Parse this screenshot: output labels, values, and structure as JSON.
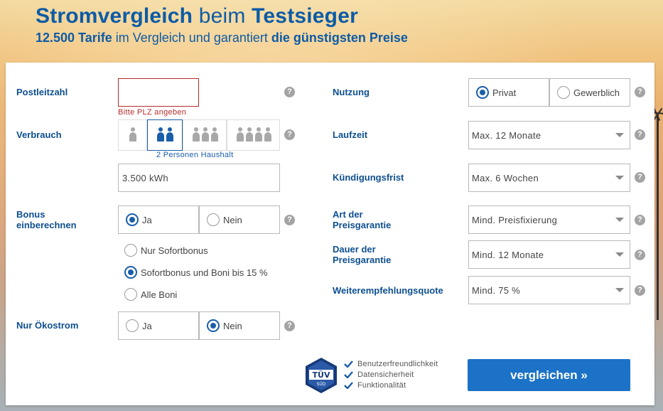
{
  "header": {
    "title_a": "Stromvergleich",
    "title_b": " beim ",
    "title_c": "Testsieger",
    "sub_a": "12.500 Tarife",
    "sub_b": " im Vergleich und garantiert ",
    "sub_c": "die günstigsten Preise"
  },
  "form": {
    "plz": {
      "label": "Postleitzahl",
      "value": "",
      "error": "Bitte PLZ angeben"
    },
    "verbrauch": {
      "label": "Verbrauch",
      "household_options": [
        1,
        2,
        3,
        4
      ],
      "selected_household": 2,
      "household_label": "2 Personen Haushalt",
      "kwh": "3.500 kWh"
    },
    "bonus": {
      "label_line1": "Bonus",
      "label_line2": "einberechnen",
      "yes": "Ja",
      "no": "Nein",
      "selected": "Ja",
      "options": [
        "Nur Sofortbonus",
        "Sofortbonus und Boni bis 15 %",
        "Alle Boni"
      ],
      "selected_option": "Sofortbonus und Boni bis 15 %"
    },
    "oekostrom": {
      "label": "Nur Ökostrom",
      "yes": "Ja",
      "no": "Nein",
      "selected": "Nein"
    },
    "nutzung": {
      "label": "Nutzung",
      "opt1": "Privat",
      "opt2": "Gewerblich",
      "selected": "Privat"
    },
    "laufzeit": {
      "label": "Laufzeit",
      "value": "Max. 12 Monate"
    },
    "kuendigung": {
      "label": "Kündigungsfrist",
      "value": "Max. 6 Wochen"
    },
    "preisgarantie_art": {
      "label_line1": "Art der",
      "label_line2": "Preisgarantie",
      "value": "Mind. Preisfixierung"
    },
    "preisgarantie_dauer": {
      "label_line1": "Dauer der",
      "label_line2": "Preisgarantie",
      "value": "Mind. 12 Monate"
    },
    "weiterempfehlung": {
      "label": "Weiterempfehlungsquote",
      "value": "Mind. 75 %"
    },
    "help_glyph": "?"
  },
  "trust": {
    "badge_text_1": "TÜV",
    "badge_text_2": "SÜD",
    "items": [
      "Benutzerfreundlichkeit",
      "Datensicherheit",
      "Funktionalität"
    ]
  },
  "submit_label": "vergleichen »",
  "colors": {
    "brand": "#0d5ba6",
    "button": "#1b72c7",
    "error": "#b52b2b"
  }
}
